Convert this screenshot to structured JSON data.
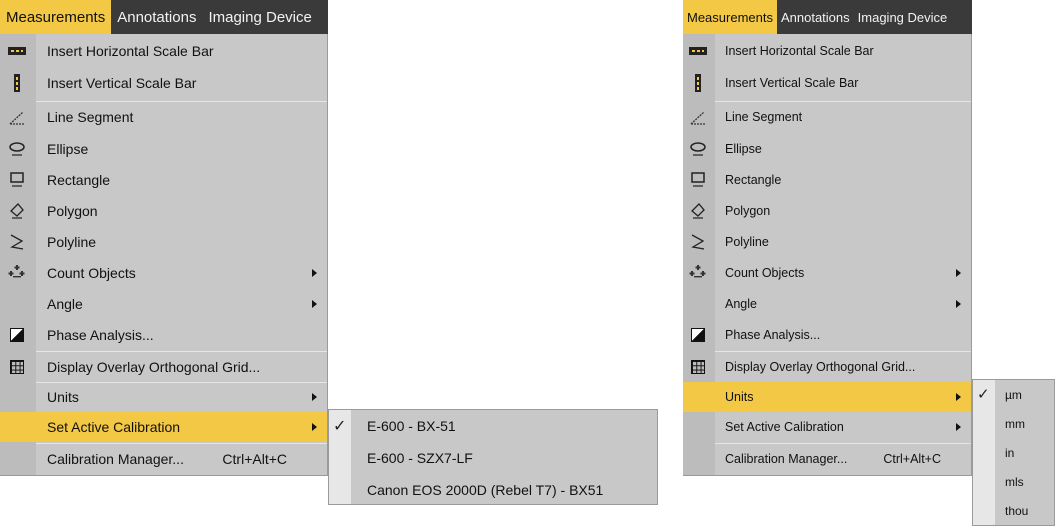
{
  "menubar": {
    "items": [
      "Measurements",
      "Annotations",
      "Imaging Device"
    ]
  },
  "menu": {
    "insert_hbar": "Insert Horizontal Scale Bar",
    "insert_vbar": "Insert Vertical Scale Bar",
    "line_segment": "Line Segment",
    "ellipse": "Ellipse",
    "rectangle": "Rectangle",
    "polygon": "Polygon",
    "polyline": "Polyline",
    "count_objects": "Count Objects",
    "angle": "Angle",
    "phase_analysis": "Phase Analysis...",
    "display_grid": "Display Overlay Orthogonal Grid...",
    "units": "Units",
    "set_active_calibration": "Set Active Calibration",
    "calibration_manager": "Calibration Manager...",
    "calibration_shortcut": "Ctrl+Alt+C"
  },
  "calibration_submenu": {
    "items": [
      "E-600 - BX-51",
      "E-600 - SZX7-LF",
      "Canon EOS 2000D (Rebel T7) - BX51"
    ],
    "checked_index": 0
  },
  "units_submenu": {
    "items": [
      "µm",
      "mm",
      "in",
      "mls",
      "thou"
    ],
    "checked_index": 0
  },
  "icons": {
    "line_segment": "line-segment-icon",
    "ellipse": "ellipse-icon",
    "rectangle": "rectangle-icon",
    "polygon": "polygon-icon",
    "polyline": "polyline-icon",
    "count_objects": "count-objects-icon"
  },
  "colors": {
    "highlight": "#f3c844",
    "menu_bg": "#c8c8c8",
    "menubar_bg": "#3a3a3a"
  }
}
